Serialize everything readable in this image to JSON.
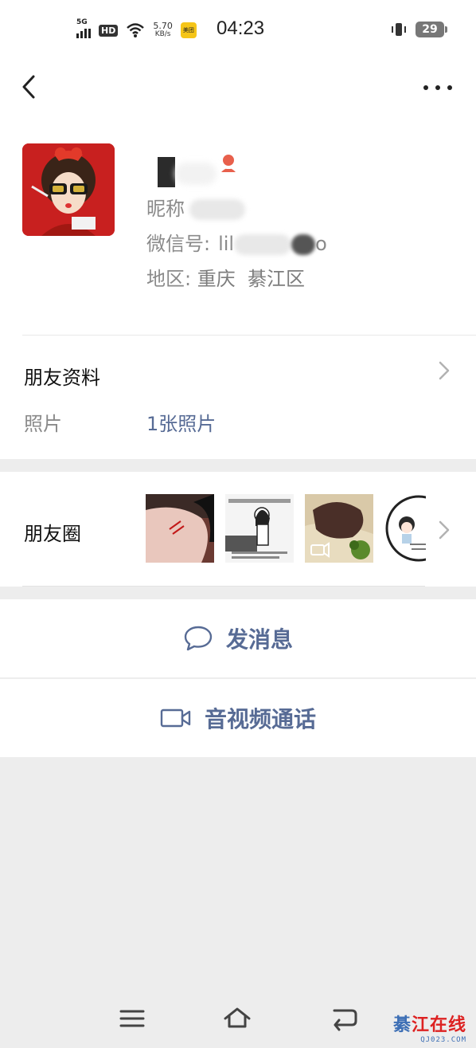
{
  "status_bar": {
    "network": "5G",
    "hd": "HD",
    "speed_value": "5.70",
    "speed_unit": "KB/s",
    "app_badge": "美团",
    "time": "04:23",
    "battery": "29"
  },
  "profile": {
    "nickname_label": "昵称",
    "nickname_value": "",
    "wechat_id_label": "微信号:",
    "wechat_id_value": "lil",
    "wechat_id_tail": "o",
    "region_label": "地区:",
    "region_value": "重庆  綦江区",
    "gender_color": "#e8604c"
  },
  "friend_info": {
    "title": "朋友资料",
    "photos_label": "照片",
    "photos_value": "1张照片"
  },
  "moments": {
    "title": "朋友圈",
    "thumb_names": [
      "photo-hand",
      "photo-sketch-girl",
      "photo-noodle-video",
      "photo-cartoon-tang"
    ]
  },
  "actions": {
    "message_label": "发消息",
    "call_label": "音视频通话"
  },
  "watermark": {
    "first_char": "綦",
    "rest": "江在线",
    "domain": "QJ023.COM"
  },
  "colors": {
    "link_blue": "#576b95",
    "gray_text": "#8a8a8a",
    "page_bg": "#ededed"
  }
}
